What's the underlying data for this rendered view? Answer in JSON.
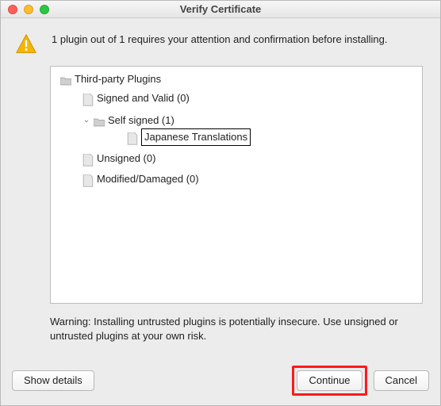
{
  "window": {
    "title": "Verify Certificate"
  },
  "message": "1 plugin out of 1 requires your attention and confirmation before installing.",
  "tree": {
    "root_label": "Third-party Plugins",
    "signed_label": "Signed and Valid (0)",
    "self_signed_label": "Self signed (1)",
    "self_signed_children": {
      "item1": "Japanese Translations"
    },
    "unsigned_label": "Unsigned (0)",
    "modified_label": "Modified/Damaged (0)"
  },
  "warning": "Warning: Installing untrusted plugins is potentially insecure. Use unsigned or untrusted plugins at your own risk.",
  "buttons": {
    "show_details": "Show details",
    "continue": "Continue",
    "cancel": "Cancel"
  }
}
